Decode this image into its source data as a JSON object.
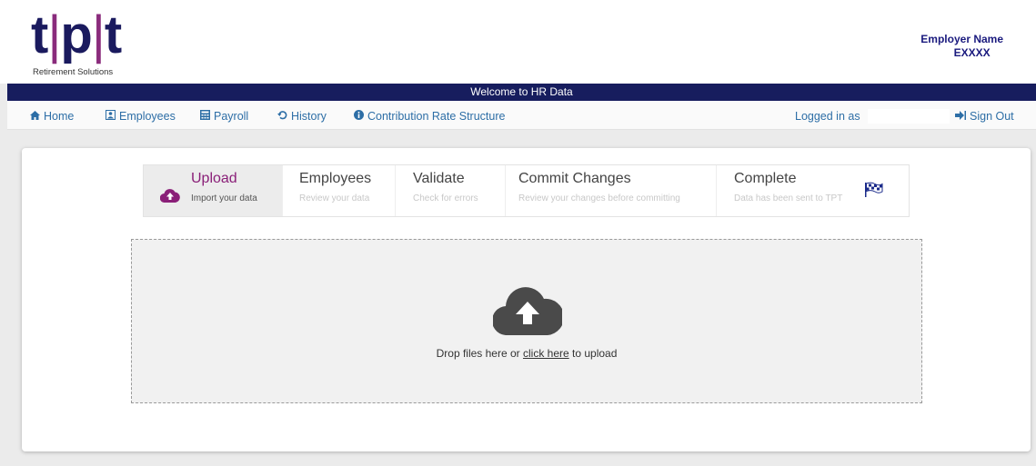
{
  "header": {
    "logo_text": "tpt",
    "logo_subtitle": "Retirement Solutions",
    "employer_name": "Employer Name",
    "employer_code": "EXXXX"
  },
  "welcome_text": "Welcome to HR Data",
  "nav": {
    "items": [
      {
        "icon": "home-icon",
        "label": "Home"
      },
      {
        "icon": "employees-icon",
        "label": "Employees"
      },
      {
        "icon": "payroll-icon",
        "label": "Payroll"
      },
      {
        "icon": "history-icon",
        "label": "History"
      },
      {
        "icon": "info-icon",
        "label": "Contribution Rate Structure"
      }
    ],
    "logged_in_label": "Logged in as",
    "logged_in_value": "",
    "sign_out": "Sign Out"
  },
  "wizard": {
    "steps": [
      {
        "title": "Upload",
        "subtitle": "Import your data",
        "active": true
      },
      {
        "title": "Employees",
        "subtitle": "Review your data",
        "active": false
      },
      {
        "title": "Validate",
        "subtitle": "Check for errors",
        "active": false
      },
      {
        "title": "Commit Changes",
        "subtitle": "Review your changes before committing",
        "active": false
      },
      {
        "title": "Complete",
        "subtitle": "Data has been sent to TPT",
        "active": false
      }
    ]
  },
  "dropzone": {
    "text_before": "Drop files here or ",
    "link_text": "click here",
    "text_after": " to upload"
  },
  "colors": {
    "brand_navy": "#171d5e",
    "brand_purple": "#8a1f78",
    "nav_link": "#2d6ea6"
  }
}
